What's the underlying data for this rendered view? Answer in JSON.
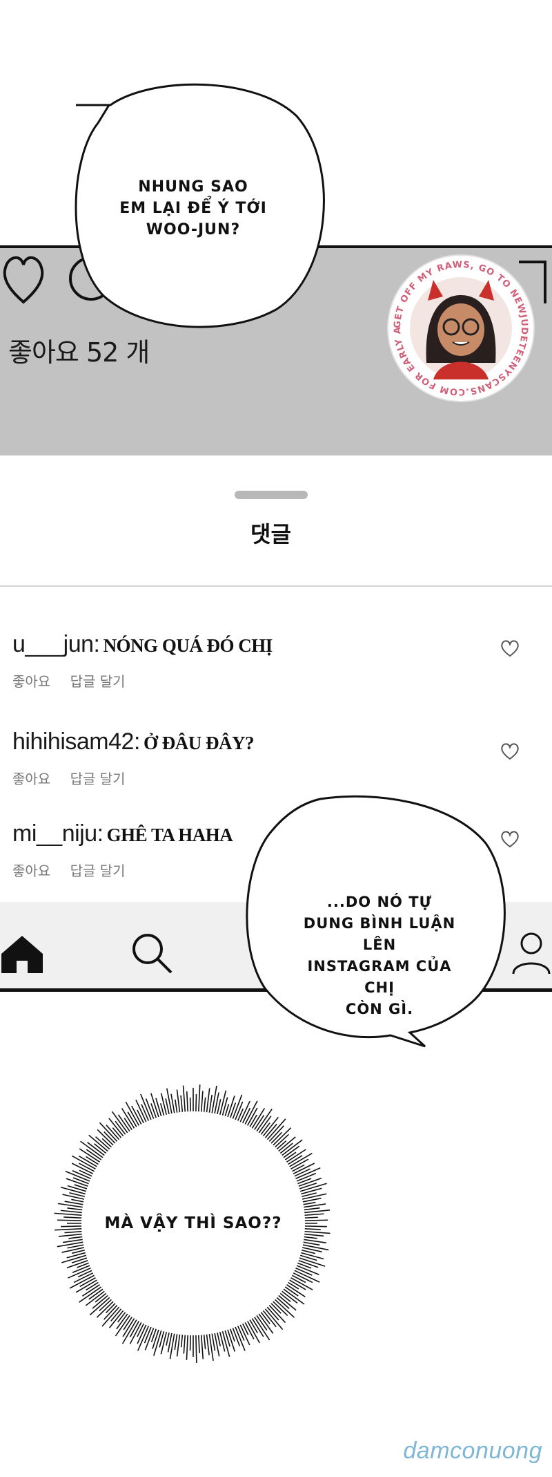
{
  "bubbles": {
    "top": {
      "line1": "NHUNG SAO",
      "line2": "EM LẠI ĐỂ Ý TỚI",
      "line3": "WOO-JUN?"
    },
    "middle": {
      "line1": "...DO NÓ TỰ",
      "line2": "DUNG BÌNH LUẬN LÊN",
      "line3": "INSTAGRAM CỦA CHỊ",
      "line4": "CÒN GÌ."
    },
    "burst": {
      "text": "MÀ VẬY THÌ SAO??"
    }
  },
  "post": {
    "likes_label": "좋아요 52 개"
  },
  "sheet": {
    "title": "댓글"
  },
  "comments": [
    {
      "user": "u___jun:",
      "text": "NÓNG QUÁ ĐÓ CHỊ",
      "like": "좋아요",
      "reply": "답글 달기"
    },
    {
      "user": "hihihisam42:",
      "text": "Ở ĐÂU ĐÂY?",
      "like": "좋아요",
      "reply": "답글 달기"
    },
    {
      "user": "mi__niju:",
      "text": "GHÊ TA HAHA",
      "like": "좋아요",
      "reply": "답글 달기"
    }
  ],
  "stamp": {
    "ring_text": "GET OFF MY RAWS, GO TO NEWJUDETEENYSCANS.COM FOR EARLY ACCESS"
  },
  "watermark": "damconuong",
  "icons": [
    "heart-icon",
    "comment-icon",
    "share-icon",
    "home-icon",
    "search-icon",
    "profile-icon"
  ]
}
